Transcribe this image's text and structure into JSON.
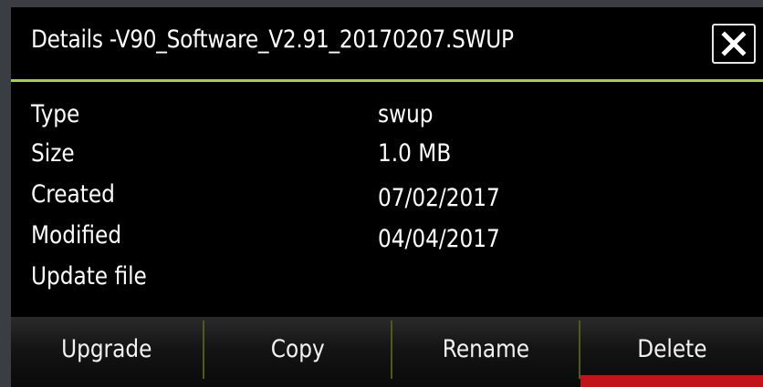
{
  "dialog": {
    "title": "Details -V90_Software_V2.91_20170207.SWUP",
    "close_icon": "close-icon",
    "accent_color": "#a6d23a"
  },
  "properties": [
    {
      "label": "Type",
      "value": "swup"
    },
    {
      "label": "Size",
      "value": "1.0 MB"
    },
    {
      "label": "Created",
      "value": "07/02/2017"
    },
    {
      "label": "Modified",
      "value": "04/04/2017"
    },
    {
      "label": "Update file",
      "value": ""
    }
  ],
  "toolbar": {
    "upgrade_label": "Upgrade",
    "copy_label": "Copy",
    "rename_label": "Rename",
    "delete_label": "Delete",
    "active_indicator_color": "#c0131a"
  }
}
